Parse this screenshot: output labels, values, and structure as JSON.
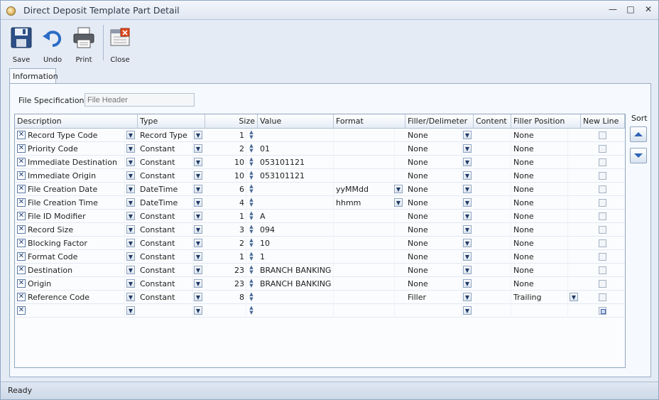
{
  "window": {
    "title": "Direct Deposit Template Part Detail"
  },
  "toolbar": {
    "save": "Save",
    "undo": "Undo",
    "print": "Print",
    "close": "Close"
  },
  "tabs": [
    "Information"
  ],
  "file_spec": {
    "label": "File Specification",
    "placeholder": "File Header"
  },
  "grid": {
    "columns": [
      "Description",
      "Type",
      "Size",
      "Value",
      "Format",
      "Filler/Delimeter",
      "Content",
      "Filler Position",
      "New Line"
    ],
    "rows": [
      {
        "description": "Record Type Code",
        "type": "Record Type",
        "size": "1",
        "value": "",
        "format": "",
        "filler": "None",
        "content": "",
        "filler_position": "None"
      },
      {
        "description": "Priority Code",
        "type": "Constant",
        "size": "2",
        "value": "01",
        "format": "",
        "filler": "None",
        "content": "",
        "filler_position": "None"
      },
      {
        "description": "Immediate Destination",
        "type": "Constant",
        "size": "10",
        "value": " 053101121",
        "format": "",
        "filler": "None",
        "content": "",
        "filler_position": "None"
      },
      {
        "description": "Immediate Origin",
        "type": "Constant",
        "size": "10",
        "value": " 053101121",
        "format": "",
        "filler": "None",
        "content": "",
        "filler_position": "None"
      },
      {
        "description": "File Creation Date",
        "type": "DateTime",
        "size": "6",
        "value": "",
        "format": "yyMMdd",
        "filler": "None",
        "content": "",
        "filler_position": "None"
      },
      {
        "description": "File Creation Time",
        "type": "DateTime",
        "size": "4",
        "value": "",
        "format": "hhmm",
        "filler": "None",
        "content": "",
        "filler_position": "None"
      },
      {
        "description": "File ID Modifier",
        "type": "Constant",
        "size": "1",
        "value": "A",
        "format": "",
        "filler": "None",
        "content": "",
        "filler_position": "None"
      },
      {
        "description": "Record Size",
        "type": "Constant",
        "size": "3",
        "value": "094",
        "format": "",
        "filler": "None",
        "content": "",
        "filler_position": "None"
      },
      {
        "description": "Blocking Factor",
        "type": "Constant",
        "size": "2",
        "value": "10",
        "format": "",
        "filler": "None",
        "content": "",
        "filler_position": "None"
      },
      {
        "description": "Format Code",
        "type": "Constant",
        "size": "1",
        "value": "1",
        "format": "",
        "filler": "None",
        "content": "",
        "filler_position": "None"
      },
      {
        "description": "Destination",
        "type": "Constant",
        "size": "23",
        "value": "BRANCH BANKING &",
        "format": "",
        "filler": "None",
        "content": "",
        "filler_position": "None"
      },
      {
        "description": "Origin",
        "type": "Constant",
        "size": "23",
        "value": "BRANCH BANKING &",
        "format": "",
        "filler": "None",
        "content": "",
        "filler_position": "None"
      },
      {
        "description": "Reference Code",
        "type": "Constant",
        "size": "8",
        "value": "",
        "format": "",
        "filler": "Filler",
        "content": "",
        "filler_position": "Trailing"
      },
      {
        "description": "",
        "type": "",
        "size": "",
        "value": "",
        "format": "",
        "filler": "",
        "content": "",
        "filler_position": ""
      }
    ]
  },
  "sort": {
    "label": "Sort"
  },
  "status": {
    "text": "Ready"
  },
  "icons": {
    "save": "save-disk-icon",
    "undo": "undo-arrow-icon",
    "print": "printer-icon",
    "close": "close-window-icon",
    "sort_up": "arrow-up-icon",
    "sort_down": "arrow-down-icon"
  }
}
